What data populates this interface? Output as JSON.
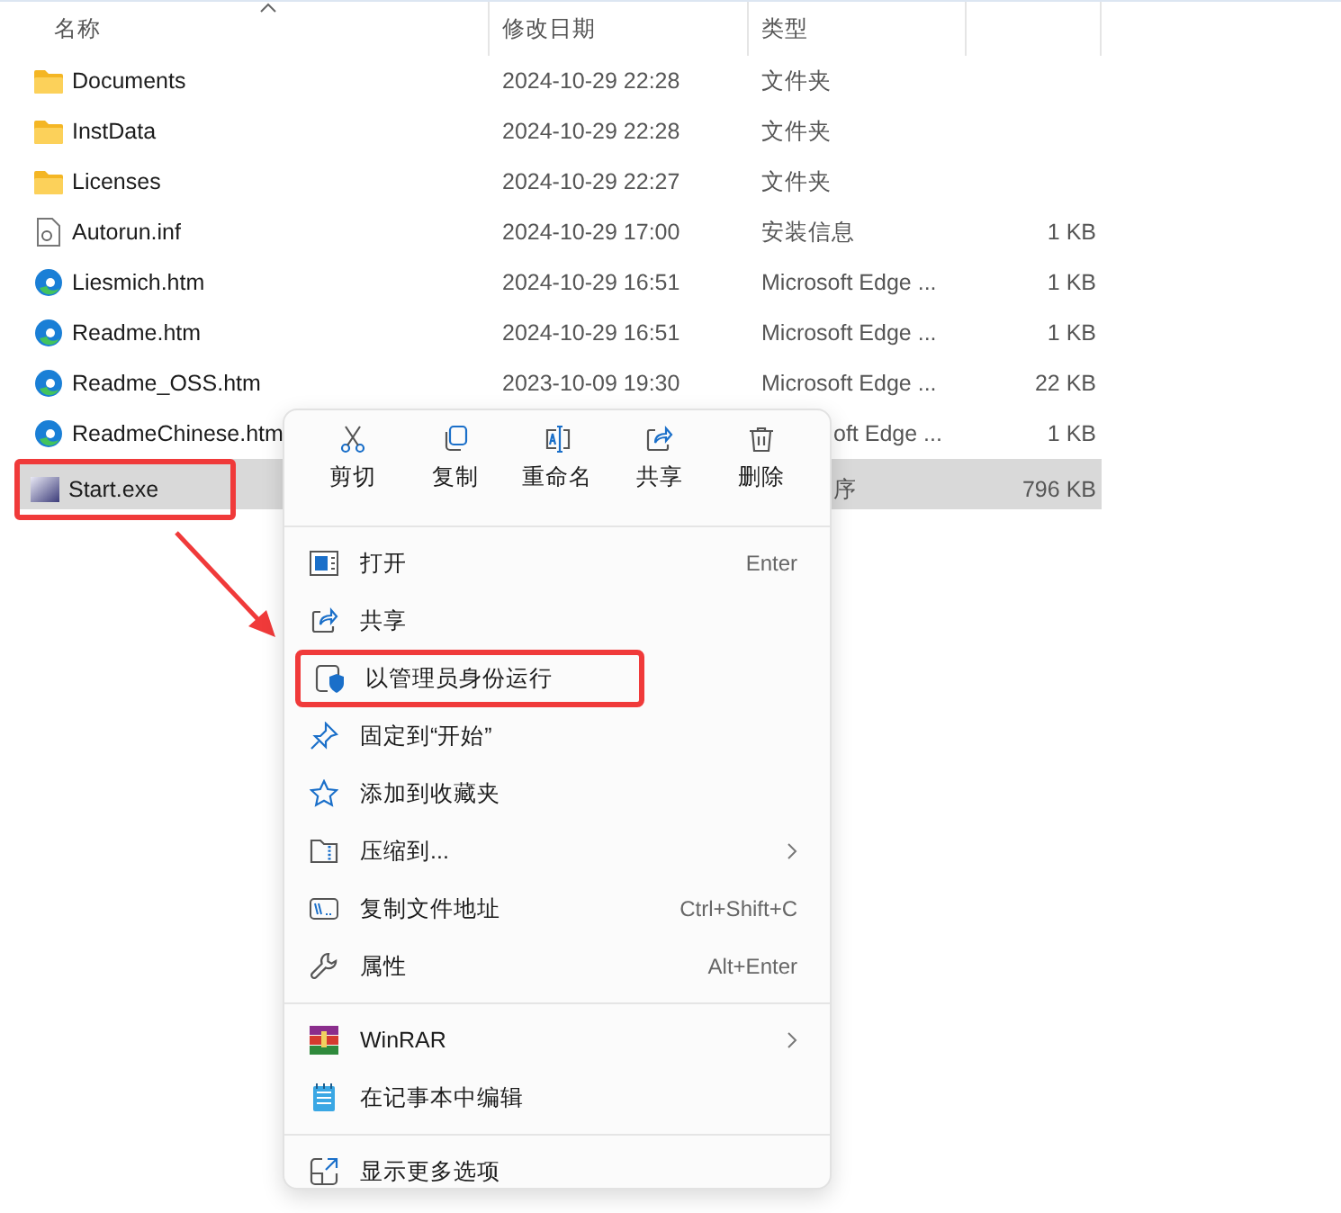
{
  "columns": [
    {
      "label": "名称",
      "sorted": true
    },
    {
      "label": "修改日期",
      "sorted": false
    },
    {
      "label": "类型",
      "sorted": false
    }
  ],
  "files": [
    {
      "name": "Documents",
      "kind": "folder",
      "modified": "2024-10-29 22:28",
      "type": "文件夹",
      "selected": false,
      "annotated": false
    },
    {
      "name": "InstData",
      "kind": "folder",
      "modified": "2024-10-29 22:28",
      "type": "文件夹",
      "selected": false,
      "annotated": false
    },
    {
      "name": "Licenses",
      "kind": "folder",
      "modified": "2024-10-29 22:27",
      "type": "文件夹",
      "selected": false,
      "annotated": false
    },
    {
      "name": "Autorun.inf",
      "kind": "inf",
      "modified": "2024-10-29 17:00",
      "type": "安装信息",
      "size": "1 KB",
      "selected": false,
      "annotated": false
    },
    {
      "name": "Liesmich.htm",
      "kind": "edge",
      "modified": "2024-10-29 16:51",
      "type": "Microsoft Edge ...",
      "size": "1 KB",
      "selected": false,
      "annotated": false
    },
    {
      "name": "Readme.htm",
      "kind": "edge",
      "modified": "2024-10-29 16:51",
      "type": "Microsoft Edge ...",
      "size": "1 KB",
      "selected": false,
      "annotated": false
    },
    {
      "name": "Readme_OSS.htm",
      "kind": "edge",
      "modified": "2023-10-09 19:30",
      "type": "Microsoft Edge ...",
      "size": "22 KB",
      "selected": false,
      "annotated": false
    },
    {
      "name": "ReadmeChinese.htm",
      "kind": "edge",
      "type": "oft Edge ...",
      "type_covered": true,
      "size": "1 KB",
      "selected": false,
      "annotated": false
    },
    {
      "name": "Start.exe",
      "kind": "exe",
      "type": "序",
      "type_covered": true,
      "size": "796 KB",
      "selected": true,
      "annotated": true
    }
  ],
  "context_menu": {
    "toolbar": [
      {
        "label": "剪切",
        "kind": "cut"
      },
      {
        "label": "复制",
        "kind": "copy"
      },
      {
        "label": "重命名",
        "kind": "rename"
      },
      {
        "label": "共享",
        "kind": "share"
      },
      {
        "label": "删除",
        "kind": "delete"
      }
    ],
    "sections": [
      [
        {
          "label": "打开",
          "kind": "open",
          "shortcut": "Enter",
          "submenu": false,
          "annotated": false
        },
        {
          "label": "共享",
          "kind": "share",
          "submenu": false,
          "annotated": false
        },
        {
          "label": "以管理员身份运行",
          "kind": "shield",
          "submenu": false,
          "annotated": true
        },
        {
          "label": "固定到“开始”",
          "kind": "pin",
          "submenu": false,
          "annotated": false
        },
        {
          "label": "添加到收藏夹",
          "kind": "star",
          "submenu": false,
          "annotated": false
        },
        {
          "label": "压缩到...",
          "kind": "zip",
          "submenu": true,
          "annotated": false
        },
        {
          "label": "复制文件地址",
          "kind": "path",
          "shortcut": "Ctrl+Shift+C",
          "submenu": false,
          "annotated": false
        },
        {
          "label": "属性",
          "kind": "wrench",
          "shortcut": "Alt+Enter",
          "submenu": false,
          "annotated": false
        }
      ],
      [
        {
          "label": "WinRAR",
          "kind": "rar",
          "submenu": true,
          "annotated": false
        },
        {
          "label": "在记事本中编辑",
          "kind": "notepad",
          "submenu": false,
          "annotated": false
        }
      ],
      [
        {
          "label": "显示更多选项",
          "kind": "more",
          "submenu": false,
          "annotated": false
        }
      ]
    ]
  }
}
